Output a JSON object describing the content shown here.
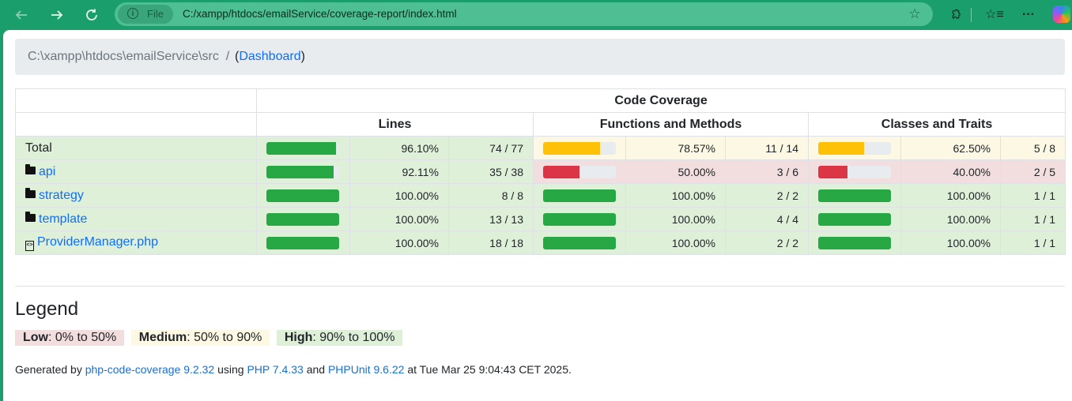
{
  "browser": {
    "chip_label": "File",
    "url": "C:/xampp/htdocs/emailService/coverage-report/index.html"
  },
  "breadcrumb": {
    "path": "C:\\xampp\\htdocs\\emailService\\src",
    "separator": "/",
    "open_paren": "(",
    "dashboard": "Dashboard",
    "close_paren": ")"
  },
  "table": {
    "header_main": "Code Coverage",
    "col_lines": "Lines",
    "col_functions": "Functions and Methods",
    "col_classes": "Classes and Traits",
    "rows": [
      {
        "name": "Total",
        "type": "total",
        "lines_pct": "96.10%",
        "lines_ratio": "74 / 77",
        "lines_fill": 0.961,
        "lines_level": "success",
        "funcs_pct": "78.57%",
        "funcs_ratio": "11 / 14",
        "funcs_fill": 0.7857,
        "funcs_level": "warning",
        "classes_pct": "62.50%",
        "classes_ratio": "5 / 8",
        "classes_fill": 0.625,
        "classes_level": "warning"
      },
      {
        "name": "api",
        "type": "folder",
        "lines_pct": "92.11%",
        "lines_ratio": "35 / 38",
        "lines_fill": 0.9211,
        "lines_level": "success",
        "funcs_pct": "50.00%",
        "funcs_ratio": "3 / 6",
        "funcs_fill": 0.5,
        "funcs_level": "danger",
        "classes_pct": "40.00%",
        "classes_ratio": "2 / 5",
        "classes_fill": 0.4,
        "classes_level": "danger"
      },
      {
        "name": "strategy",
        "type": "folder",
        "lines_pct": "100.00%",
        "lines_ratio": "8 / 8",
        "lines_fill": 1.0,
        "lines_level": "success",
        "funcs_pct": "100.00%",
        "funcs_ratio": "2 / 2",
        "funcs_fill": 1.0,
        "funcs_level": "success",
        "classes_pct": "100.00%",
        "classes_ratio": "1 / 1",
        "classes_fill": 1.0,
        "classes_level": "success"
      },
      {
        "name": "template",
        "type": "folder",
        "lines_pct": "100.00%",
        "lines_ratio": "13 / 13",
        "lines_fill": 1.0,
        "lines_level": "success",
        "funcs_pct": "100.00%",
        "funcs_ratio": "4 / 4",
        "funcs_fill": 1.0,
        "funcs_level": "success",
        "classes_pct": "100.00%",
        "classes_ratio": "1 / 1",
        "classes_fill": 1.0,
        "classes_level": "success"
      },
      {
        "name": "ProviderManager.php",
        "type": "file",
        "lines_pct": "100.00%",
        "lines_ratio": "18 / 18",
        "lines_fill": 1.0,
        "lines_level": "success",
        "funcs_pct": "100.00%",
        "funcs_ratio": "2 / 2",
        "funcs_fill": 1.0,
        "funcs_level": "success",
        "classes_pct": "100.00%",
        "classes_ratio": "1 / 1",
        "classes_fill": 1.0,
        "classes_level": "success"
      }
    ]
  },
  "legend": {
    "title": "Legend",
    "low_label": "Low",
    "low_range": ": 0% to 50%",
    "medium_label": "Medium",
    "medium_range": ": 50% to 90%",
    "high_label": "High",
    "high_range": ": 90% to 100%"
  },
  "footer": {
    "generated_by": "Generated by",
    "tool": "php-code-coverage 9.2.32",
    "using": "using",
    "php": "PHP 7.4.33",
    "and": "and",
    "phpunit": "PHPUnit 9.6.22",
    "at": "at Tue Mar 25 9:04:43 CET 2025."
  },
  "colors": {
    "chrome": "#1a9f6c",
    "success": "#dff0d8",
    "warning": "#fcf8e3",
    "danger": "#f2dede",
    "bar_green": "#28a745",
    "bar_yellow": "#ffc107",
    "bar_red": "#dc3545"
  }
}
